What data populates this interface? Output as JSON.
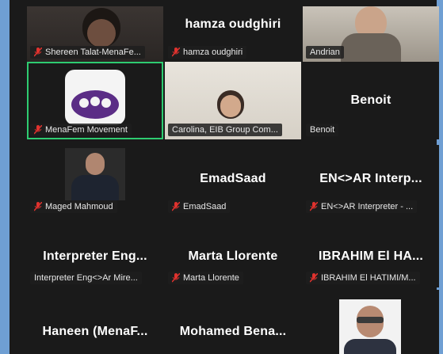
{
  "tiles": [
    {
      "label": "Shereen Talat-MenaFe...",
      "muted": true
    },
    {
      "big_name": "hamza oudghiri",
      "label": "hamza oudghiri",
      "muted": true
    },
    {
      "label": "Andrian",
      "muted": false
    },
    {
      "label": "MenaFem Movement",
      "muted": true,
      "active": true
    },
    {
      "label": "Carolina, EIB Group Com...",
      "muted": false
    },
    {
      "big_name": "Benoit",
      "label": "Benoit",
      "muted": false
    },
    {
      "label": "Maged Mahmoud",
      "muted": true
    },
    {
      "big_name": "EmadSaad",
      "label": "EmadSaad",
      "muted": true
    },
    {
      "big_name": "EN<>AR  Interp...",
      "label": "EN<>AR Interpreter - ...",
      "muted": true
    },
    {
      "big_name": "Interpreter  Eng...",
      "label": "Interpreter Eng<>Ar Mire...",
      "muted": false
    },
    {
      "big_name": "Marta Llorente",
      "label": "Marta Llorente",
      "muted": true
    },
    {
      "big_name": "IBRAHIM El HA...",
      "label": "IBRAHIM El HATIMI/M...",
      "muted": true
    },
    {
      "big_name": "Haneen  (MenaF...",
      "muted": false
    },
    {
      "big_name": "Mohamed  Bena...",
      "muted": false
    },
    {
      "muted": false
    }
  ],
  "colors": {
    "active_border": "#2ecc71",
    "muted_icon": "#e0322e",
    "frame": "#6f9fd3"
  }
}
